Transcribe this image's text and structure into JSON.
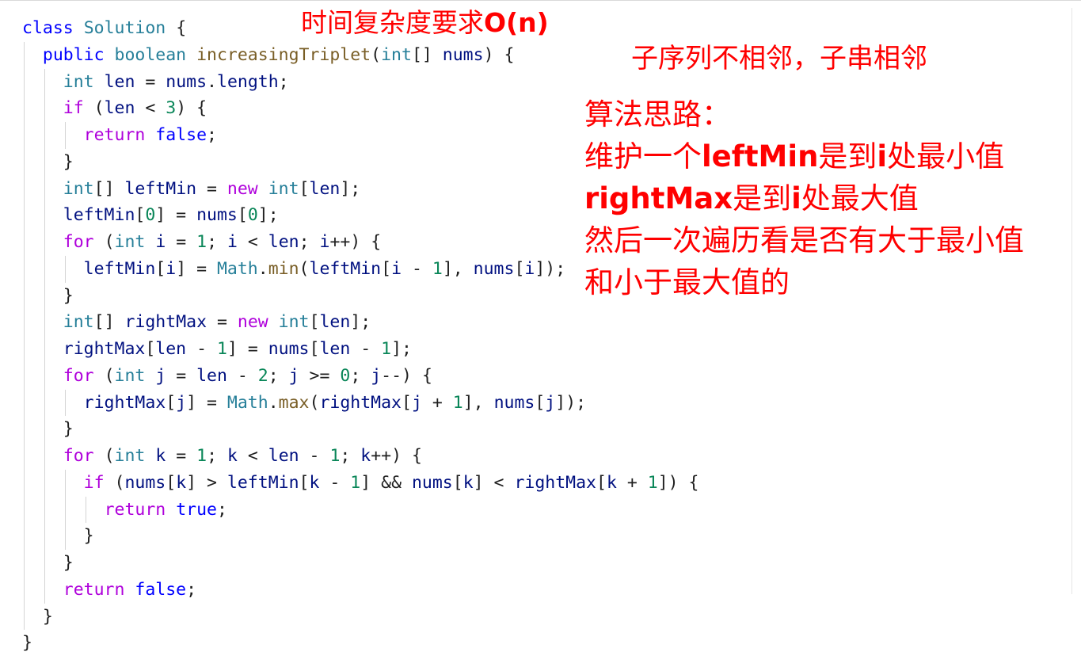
{
  "code_lines": [
    {
      "indent": 0,
      "tokens": [
        {
          "t": "class",
          "c": "kw"
        },
        {
          "t": " "
        },
        {
          "t": "Solution",
          "c": "typ"
        },
        {
          "t": " {"
        }
      ]
    },
    {
      "indent": 1,
      "tokens": [
        {
          "t": "public",
          "c": "kw"
        },
        {
          "t": " "
        },
        {
          "t": "boolean",
          "c": "typ"
        },
        {
          "t": " "
        },
        {
          "t": "increasingTriplet",
          "c": "fn"
        },
        {
          "t": "("
        },
        {
          "t": "int",
          "c": "typ"
        },
        {
          "t": "[] "
        },
        {
          "t": "nums",
          "c": "var"
        },
        {
          "t": ") {"
        }
      ]
    },
    {
      "indent": 2,
      "tokens": [
        {
          "t": "int",
          "c": "typ"
        },
        {
          "t": " "
        },
        {
          "t": "len",
          "c": "var"
        },
        {
          "t": " = "
        },
        {
          "t": "nums",
          "c": "var"
        },
        {
          "t": "."
        },
        {
          "t": "length",
          "c": "var"
        },
        {
          "t": ";"
        }
      ]
    },
    {
      "indent": 2,
      "tokens": [
        {
          "t": "if",
          "c": "ctl"
        },
        {
          "t": " ("
        },
        {
          "t": "len",
          "c": "var"
        },
        {
          "t": " < "
        },
        {
          "t": "3",
          "c": "num"
        },
        {
          "t": ") {"
        }
      ]
    },
    {
      "indent": 3,
      "tokens": [
        {
          "t": "return",
          "c": "ctl"
        },
        {
          "t": " "
        },
        {
          "t": "false",
          "c": "kw"
        },
        {
          "t": ";"
        }
      ]
    },
    {
      "indent": 2,
      "tokens": [
        {
          "t": "}"
        }
      ]
    },
    {
      "indent": 2,
      "tokens": [
        {
          "t": "int",
          "c": "typ"
        },
        {
          "t": "[] "
        },
        {
          "t": "leftMin",
          "c": "var"
        },
        {
          "t": " = "
        },
        {
          "t": "new",
          "c": "ctl"
        },
        {
          "t": " "
        },
        {
          "t": "int",
          "c": "typ"
        },
        {
          "t": "["
        },
        {
          "t": "len",
          "c": "var"
        },
        {
          "t": "];"
        }
      ]
    },
    {
      "indent": 2,
      "tokens": [
        {
          "t": "leftMin",
          "c": "var"
        },
        {
          "t": "["
        },
        {
          "t": "0",
          "c": "num"
        },
        {
          "t": "] = "
        },
        {
          "t": "nums",
          "c": "var"
        },
        {
          "t": "["
        },
        {
          "t": "0",
          "c": "num"
        },
        {
          "t": "];"
        }
      ]
    },
    {
      "indent": 2,
      "tokens": [
        {
          "t": "for",
          "c": "ctl"
        },
        {
          "t": " ("
        },
        {
          "t": "int",
          "c": "typ"
        },
        {
          "t": " "
        },
        {
          "t": "i",
          "c": "var"
        },
        {
          "t": " = "
        },
        {
          "t": "1",
          "c": "num"
        },
        {
          "t": "; "
        },
        {
          "t": "i",
          "c": "var"
        },
        {
          "t": " < "
        },
        {
          "t": "len",
          "c": "var"
        },
        {
          "t": "; "
        },
        {
          "t": "i",
          "c": "var"
        },
        {
          "t": "++) {"
        }
      ]
    },
    {
      "indent": 3,
      "tokens": [
        {
          "t": "leftMin",
          "c": "var"
        },
        {
          "t": "["
        },
        {
          "t": "i",
          "c": "var"
        },
        {
          "t": "] = "
        },
        {
          "t": "Math",
          "c": "typ"
        },
        {
          "t": "."
        },
        {
          "t": "min",
          "c": "fn"
        },
        {
          "t": "("
        },
        {
          "t": "leftMin",
          "c": "var"
        },
        {
          "t": "["
        },
        {
          "t": "i",
          "c": "var"
        },
        {
          "t": " - "
        },
        {
          "t": "1",
          "c": "num"
        },
        {
          "t": "], "
        },
        {
          "t": "nums",
          "c": "var"
        },
        {
          "t": "["
        },
        {
          "t": "i",
          "c": "var"
        },
        {
          "t": "]);"
        }
      ]
    },
    {
      "indent": 2,
      "tokens": [
        {
          "t": "}"
        }
      ]
    },
    {
      "indent": 2,
      "tokens": [
        {
          "t": "int",
          "c": "typ"
        },
        {
          "t": "[] "
        },
        {
          "t": "rightMax",
          "c": "var"
        },
        {
          "t": " = "
        },
        {
          "t": "new",
          "c": "ctl"
        },
        {
          "t": " "
        },
        {
          "t": "int",
          "c": "typ"
        },
        {
          "t": "["
        },
        {
          "t": "len",
          "c": "var"
        },
        {
          "t": "];"
        }
      ]
    },
    {
      "indent": 2,
      "tokens": [
        {
          "t": "rightMax",
          "c": "var"
        },
        {
          "t": "["
        },
        {
          "t": "len",
          "c": "var"
        },
        {
          "t": " - "
        },
        {
          "t": "1",
          "c": "num"
        },
        {
          "t": "] = "
        },
        {
          "t": "nums",
          "c": "var"
        },
        {
          "t": "["
        },
        {
          "t": "len",
          "c": "var"
        },
        {
          "t": " - "
        },
        {
          "t": "1",
          "c": "num"
        },
        {
          "t": "];"
        }
      ]
    },
    {
      "indent": 2,
      "tokens": [
        {
          "t": "for",
          "c": "ctl"
        },
        {
          "t": " ("
        },
        {
          "t": "int",
          "c": "typ"
        },
        {
          "t": " "
        },
        {
          "t": "j",
          "c": "var"
        },
        {
          "t": " = "
        },
        {
          "t": "len",
          "c": "var"
        },
        {
          "t": " - "
        },
        {
          "t": "2",
          "c": "num"
        },
        {
          "t": "; "
        },
        {
          "t": "j",
          "c": "var"
        },
        {
          "t": " >= "
        },
        {
          "t": "0",
          "c": "num"
        },
        {
          "t": "; "
        },
        {
          "t": "j",
          "c": "var"
        },
        {
          "t": "--) {"
        }
      ]
    },
    {
      "indent": 3,
      "tokens": [
        {
          "t": "rightMax",
          "c": "var"
        },
        {
          "t": "["
        },
        {
          "t": "j",
          "c": "var"
        },
        {
          "t": "] = "
        },
        {
          "t": "Math",
          "c": "typ"
        },
        {
          "t": "."
        },
        {
          "t": "max",
          "c": "fn"
        },
        {
          "t": "("
        },
        {
          "t": "rightMax",
          "c": "var"
        },
        {
          "t": "["
        },
        {
          "t": "j",
          "c": "var"
        },
        {
          "t": " + "
        },
        {
          "t": "1",
          "c": "num"
        },
        {
          "t": "], "
        },
        {
          "t": "nums",
          "c": "var"
        },
        {
          "t": "["
        },
        {
          "t": "j",
          "c": "var"
        },
        {
          "t": "]);"
        }
      ]
    },
    {
      "indent": 2,
      "tokens": [
        {
          "t": "}"
        }
      ]
    },
    {
      "indent": 2,
      "tokens": [
        {
          "t": "for",
          "c": "ctl"
        },
        {
          "t": " ("
        },
        {
          "t": "int",
          "c": "typ"
        },
        {
          "t": " "
        },
        {
          "t": "k",
          "c": "var"
        },
        {
          "t": " = "
        },
        {
          "t": "1",
          "c": "num"
        },
        {
          "t": "; "
        },
        {
          "t": "k",
          "c": "var"
        },
        {
          "t": " < "
        },
        {
          "t": "len",
          "c": "var"
        },
        {
          "t": " - "
        },
        {
          "t": "1",
          "c": "num"
        },
        {
          "t": "; "
        },
        {
          "t": "k",
          "c": "var"
        },
        {
          "t": "++) {"
        }
      ]
    },
    {
      "indent": 3,
      "tokens": [
        {
          "t": "if",
          "c": "ctl"
        },
        {
          "t": " ("
        },
        {
          "t": "nums",
          "c": "var"
        },
        {
          "t": "["
        },
        {
          "t": "k",
          "c": "var"
        },
        {
          "t": "] > "
        },
        {
          "t": "leftMin",
          "c": "var"
        },
        {
          "t": "["
        },
        {
          "t": "k",
          "c": "var"
        },
        {
          "t": " - "
        },
        {
          "t": "1",
          "c": "num"
        },
        {
          "t": "] && "
        },
        {
          "t": "nums",
          "c": "var"
        },
        {
          "t": "["
        },
        {
          "t": "k",
          "c": "var"
        },
        {
          "t": "] < "
        },
        {
          "t": "rightMax",
          "c": "var"
        },
        {
          "t": "["
        },
        {
          "t": "k",
          "c": "var"
        },
        {
          "t": " + "
        },
        {
          "t": "1",
          "c": "num"
        },
        {
          "t": "]) {"
        }
      ]
    },
    {
      "indent": 4,
      "tokens": [
        {
          "t": "return",
          "c": "ctl"
        },
        {
          "t": " "
        },
        {
          "t": "true",
          "c": "kw"
        },
        {
          "t": ";"
        }
      ]
    },
    {
      "indent": 3,
      "tokens": [
        {
          "t": "}"
        }
      ]
    },
    {
      "indent": 2,
      "tokens": [
        {
          "t": "}"
        }
      ]
    },
    {
      "indent": 2,
      "tokens": [
        {
          "t": "return",
          "c": "ctl"
        },
        {
          "t": " "
        },
        {
          "t": "false",
          "c": "kw"
        },
        {
          "t": ";"
        }
      ]
    },
    {
      "indent": 1,
      "tokens": [
        {
          "t": "}"
        }
      ]
    },
    {
      "indent": 0,
      "tokens": [
        {
          "t": "}"
        }
      ]
    }
  ],
  "annotations": {
    "complexity_prefix": "时间复杂度要求",
    "complexity_bold": "O(n)",
    "subsequence_note": "子序列不相邻，子串相邻",
    "algo_heading": "算法思路：",
    "algo_line1_a": "维护一个",
    "algo_line1_b": "leftMin",
    "algo_line1_c": "是到",
    "algo_line1_d": "i",
    "algo_line1_e": "处最小值",
    "algo_line2_a": "rightMax",
    "algo_line2_b": "是到",
    "algo_line2_c": "i",
    "algo_line2_d": "处最大值",
    "algo_line3": "然后一次遍历看是否有大于最小值",
    "algo_line4": "和小于最大值的"
  },
  "colors": {
    "keyword": "#0000ff",
    "control": "#af00db",
    "type": "#267f99",
    "function": "#795e26",
    "variable": "#001080",
    "number": "#098658",
    "annotation": "#ff0000"
  }
}
